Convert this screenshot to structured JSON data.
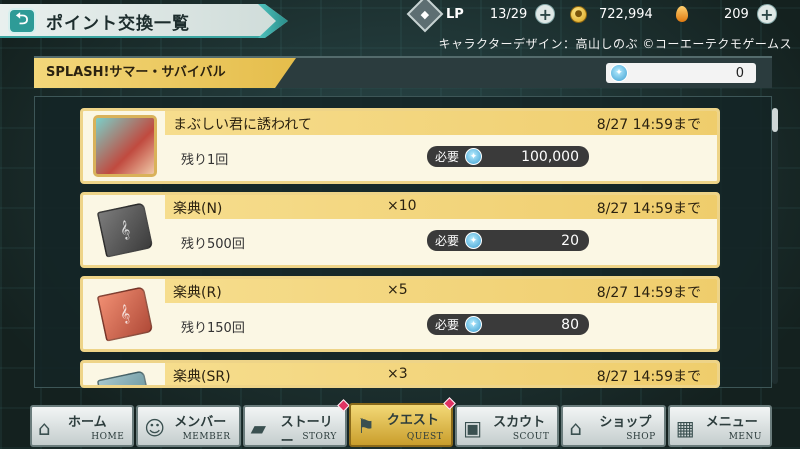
{
  "header": {
    "title": "ポイント交換一覧",
    "back_icon": "back-arrow-icon",
    "lp_label": "LP",
    "lp_value": "13/29",
    "coins_value": "722,994",
    "gems_value": "209",
    "copyright": "キャラクターデザイン：高山しのぶ ©コーエーテクモゲームス"
  },
  "event": {
    "name": "SPLASH!サマー・サバイバル",
    "ticket_count": "0"
  },
  "items": [
    {
      "name": "まぶしい君に誘われて",
      "qty": "",
      "deadline": "8/27 14:59まで",
      "remaining": "残り1回",
      "cost_label": "必要",
      "cost": "100,000",
      "thumb": "portrait"
    },
    {
      "name": "楽典(N)",
      "qty": "×10",
      "deadline": "8/27 14:59まで",
      "remaining": "残り500回",
      "cost_label": "必要",
      "cost": "20",
      "thumb": "book-n"
    },
    {
      "name": "楽典(R)",
      "qty": "×5",
      "deadline": "8/27 14:59まで",
      "remaining": "残り150回",
      "cost_label": "必要",
      "cost": "80",
      "thumb": "book-r"
    },
    {
      "name": "楽典(SR)",
      "qty": "×3",
      "deadline": "8/27 14:59まで",
      "remaining": "",
      "cost_label": "",
      "cost": "",
      "thumb": "book-sr"
    }
  ],
  "nav": [
    {
      "jp": "ホーム",
      "en": "HOME",
      "icon": "home-icon",
      "active": false,
      "badge": false
    },
    {
      "jp": "メンバー",
      "en": "MEMBER",
      "icon": "members-icon",
      "active": false,
      "badge": false
    },
    {
      "jp": "ストーリー",
      "en": "STORY",
      "icon": "book-icon",
      "active": false,
      "badge": true
    },
    {
      "jp": "クエスト",
      "en": "QUEST",
      "icon": "signpost-icon",
      "active": true,
      "badge": true
    },
    {
      "jp": "スカウト",
      "en": "SCOUT",
      "icon": "bus-icon",
      "active": false,
      "badge": false
    },
    {
      "jp": "ショップ",
      "en": "SHOP",
      "icon": "shop-icon",
      "active": false,
      "badge": false
    },
    {
      "jp": "メニュー",
      "en": "MENU",
      "icon": "grid-icon",
      "active": false,
      "badge": false
    }
  ]
}
